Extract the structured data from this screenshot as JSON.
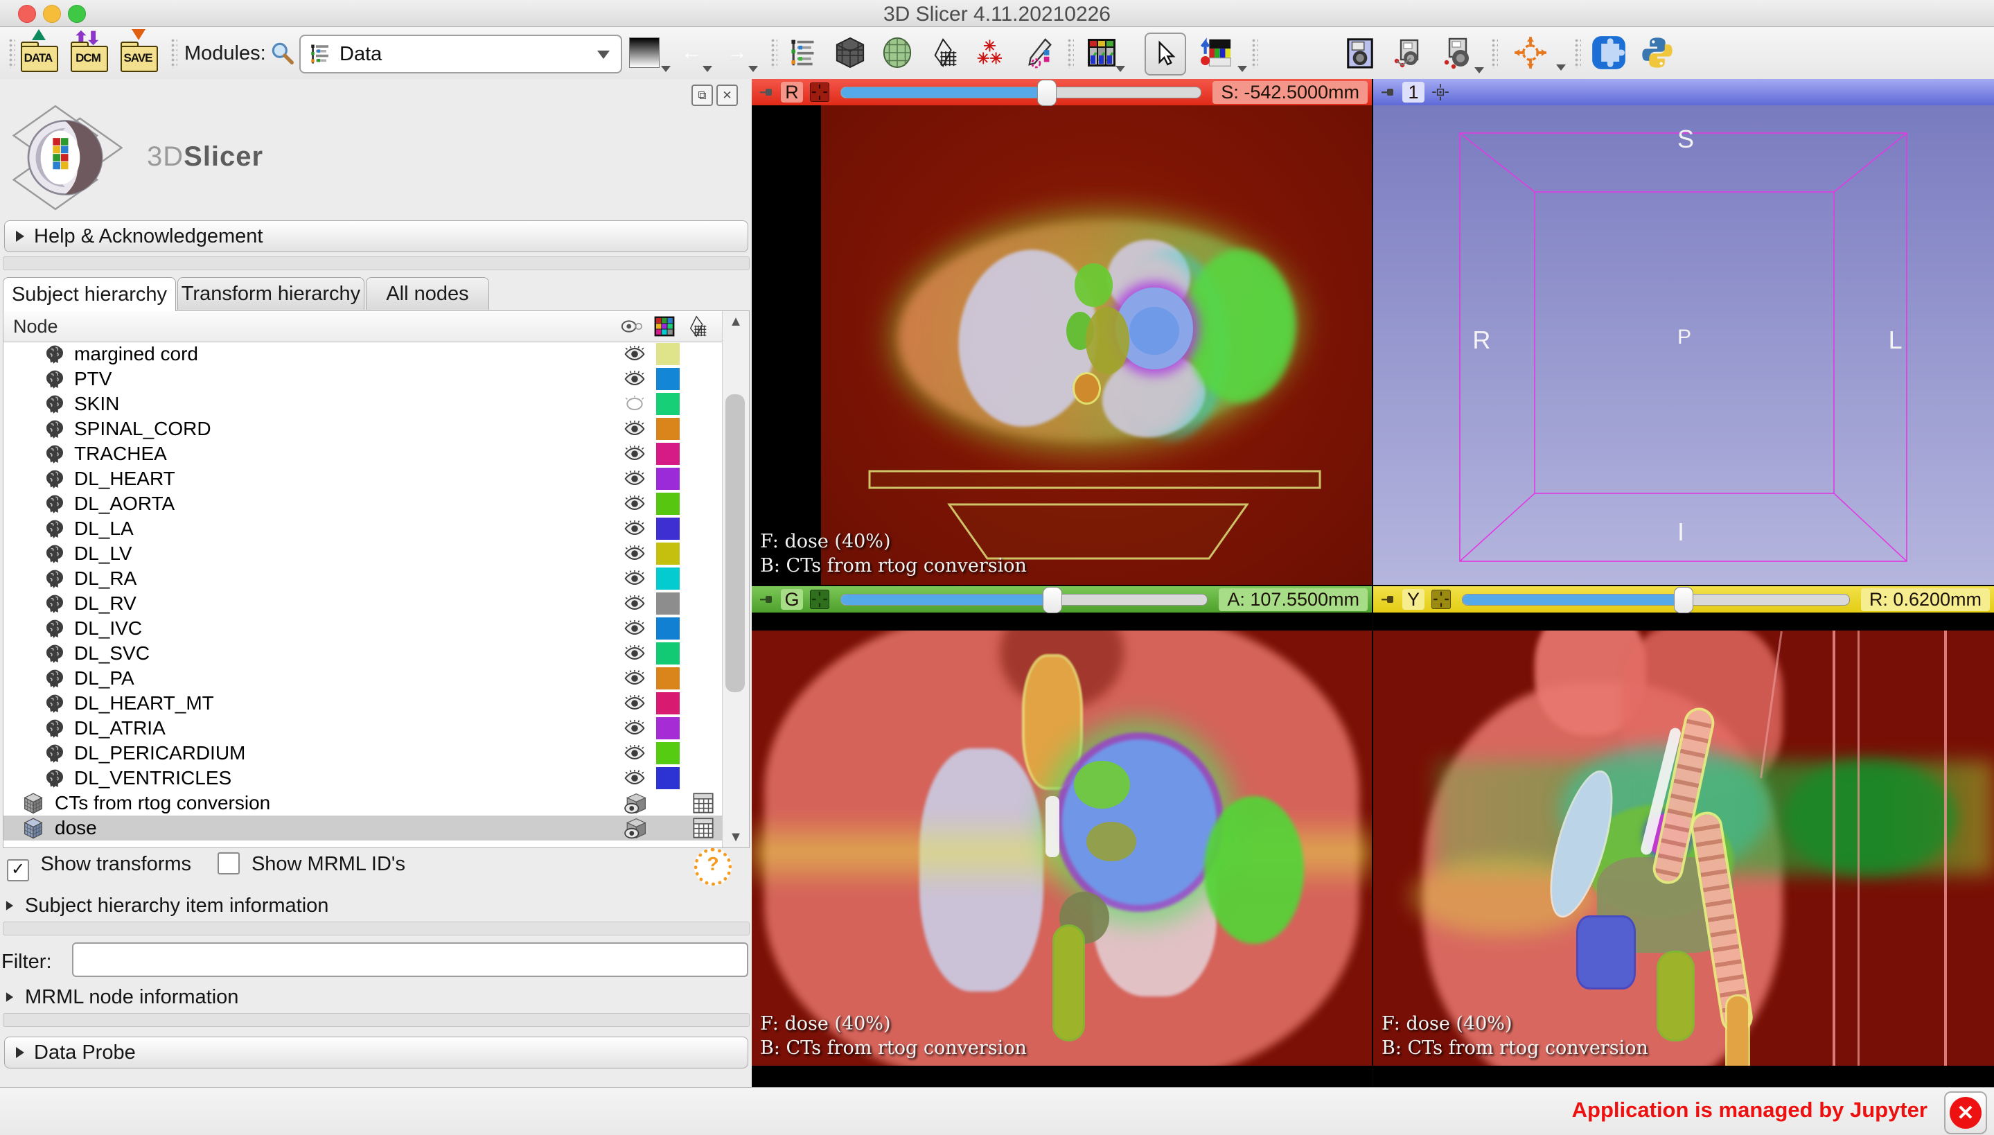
{
  "window": {
    "title": "3D Slicer 4.11.20210226"
  },
  "toolbar": {
    "modules_label": "Modules:",
    "module_selected": "Data",
    "icons": [
      "load-data-folder",
      "load-dicom-folder",
      "save-folder",
      "module-search",
      "module-list",
      "screen-capture-gradient",
      "history-back",
      "history-forward",
      "data-module",
      "volume-rendering",
      "models-module",
      "transforms-module",
      "markups-fiducial",
      "annotations-pencil",
      "layout-selector",
      "mouse-interaction",
      "adjust-window-level",
      "capture-screenshot",
      "scene-view-capture",
      "scene-view-restore",
      "crosshair",
      "extensions-manager",
      "python-console"
    ]
  },
  "panel": {
    "logo_text_3d": "3D",
    "logo_text_slicer": "Slicer",
    "help_header": "Help & Acknowledgement",
    "tabs": [
      {
        "label": "Subject hierarchy",
        "active": true
      },
      {
        "label": "Transform hierarchy",
        "active": false
      },
      {
        "label": "All nodes",
        "active": false
      }
    ],
    "tree": {
      "header": "Node",
      "items": [
        {
          "label": "margined cord",
          "type": "segmentation",
          "eye": "open",
          "color": "#dfe38a"
        },
        {
          "label": "PTV",
          "type": "segmentation",
          "eye": "open",
          "color": "#1386d6"
        },
        {
          "label": "SKIN",
          "type": "segmentation",
          "eye": "closed",
          "color": "#17cf76"
        },
        {
          "label": "SPINAL_CORD",
          "type": "segmentation",
          "eye": "open",
          "color": "#d9851c"
        },
        {
          "label": "TRACHEA",
          "type": "segmentation",
          "eye": "open",
          "color": "#d61b86"
        },
        {
          "label": "DL_HEART",
          "type": "segmentation",
          "eye": "open",
          "color": "#9b2bd9"
        },
        {
          "label": "DL_AORTA",
          "type": "segmentation",
          "eye": "open",
          "color": "#57c610"
        },
        {
          "label": "DL_LA",
          "type": "segmentation",
          "eye": "open",
          "color": "#3e2fd2"
        },
        {
          "label": "DL_LV",
          "type": "segmentation",
          "eye": "open",
          "color": "#c4c00d"
        },
        {
          "label": "DL_RA",
          "type": "segmentation",
          "eye": "open",
          "color": "#04cbd0"
        },
        {
          "label": "DL_RV",
          "type": "segmentation",
          "eye": "open",
          "color": "#8d8d8d"
        },
        {
          "label": "DL_IVC",
          "type": "segmentation",
          "eye": "open",
          "color": "#1180d2"
        },
        {
          "label": "DL_SVC",
          "type": "segmentation",
          "eye": "open",
          "color": "#13ca74"
        },
        {
          "label": "DL_PA",
          "type": "segmentation",
          "eye": "open",
          "color": "#d9851c"
        },
        {
          "label": "DL_HEART_MT",
          "type": "segmentation",
          "eye": "open",
          "color": "#d81b70"
        },
        {
          "label": "DL_ATRIA",
          "type": "segmentation",
          "eye": "open",
          "color": "#a62cd6"
        },
        {
          "label": "DL_PERICARDIUM",
          "type": "segmentation",
          "eye": "open",
          "color": "#55cc12"
        },
        {
          "label": "DL_VENTRICLES",
          "type": "segmentation",
          "eye": "open",
          "color": "#2d33d2"
        },
        {
          "label": "CTs from rtog conversion",
          "type": "volume",
          "eye": "cube",
          "grid": true,
          "selected": false
        },
        {
          "label": "dose",
          "type": "volume",
          "eye": "cube",
          "grid": true,
          "selected": true
        }
      ]
    },
    "show_transforms": {
      "label": "Show transforms",
      "checked": true
    },
    "show_mrml_ids": {
      "label": "Show MRML ID's",
      "checked": false
    },
    "item_info_header": "Subject hierarchy item information",
    "filter_label": "Filter:",
    "filter_value": "",
    "mrml_info_header": "MRML node information",
    "data_probe_header": "Data Probe"
  },
  "views": {
    "red": {
      "letter": "R",
      "value_label": "S: -542.5000mm",
      "slider_pos": 0.57,
      "overlay_fg": "F: dose (40%)",
      "overlay_bg": "B: CTs from rtog conversion",
      "accent": "#ee3e2c"
    },
    "green": {
      "letter": "G",
      "value_label": "A: 107.5500mm",
      "slider_pos": 0.575,
      "overlay_fg": "F: dose (40%)",
      "overlay_bg": "B: CTs from rtog conversion",
      "accent": "#62ba3e"
    },
    "yellow": {
      "letter": "Y",
      "value_label": "R: 0.6200mm",
      "slider_pos": 0.57,
      "overlay_fg": "F: dose (40%)",
      "overlay_bg": "B: CTs from rtog conversion",
      "accent": "#e9d52b"
    },
    "threed": {
      "label": "1",
      "axis_s": "S",
      "axis_r": "R",
      "axis_p": "P",
      "axis_l": "L",
      "axis_i": "I",
      "accent": "#7d86e2"
    }
  },
  "statusbar": {
    "message": "Application is managed by Jupyter"
  }
}
